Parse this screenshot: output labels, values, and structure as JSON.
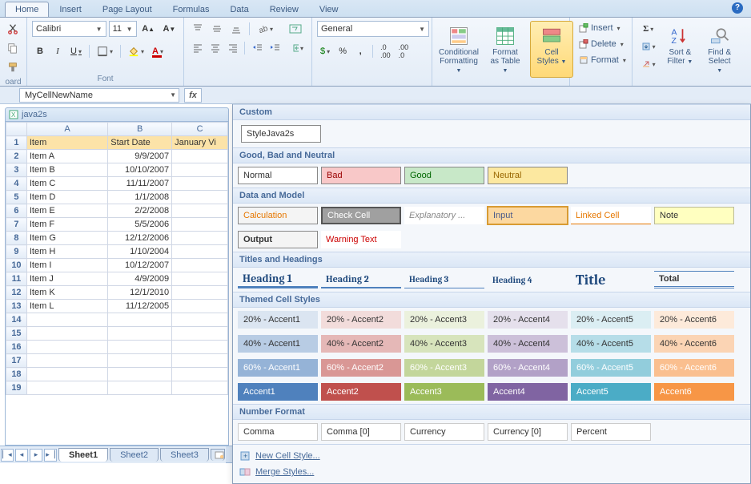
{
  "tabs": [
    "Home",
    "Insert",
    "Page Layout",
    "Formulas",
    "Data",
    "Review",
    "View"
  ],
  "activeTab": "Home",
  "font": {
    "name": "Calibri",
    "size": "11"
  },
  "numberFormatSelect": "General",
  "groups": {
    "clipboard": "oard",
    "font": "Font"
  },
  "bigButtons": {
    "conditional": "Conditional\nFormatting",
    "formatTable": "Format\nas Table",
    "cellStyles": "Cell\nStyles",
    "sortFilter": "Sort &\nFilter",
    "findSelect": "Find &\nSelect"
  },
  "cellsMenu": {
    "insert": "Insert",
    "delete": "Delete",
    "format": "Format"
  },
  "nameBox": "MyCellNewName",
  "workbookTitle": "java2s",
  "columns": [
    "A",
    "B",
    "C"
  ],
  "headerRow": {
    "A": "Item",
    "B": "Start Date",
    "C": "January Vi"
  },
  "rows": [
    {
      "A": "Item A",
      "B": "9/9/2007"
    },
    {
      "A": "Item B",
      "B": "10/10/2007"
    },
    {
      "A": "Item C",
      "B": "11/11/2007"
    },
    {
      "A": "Item D",
      "B": "1/1/2008"
    },
    {
      "A": "Item E",
      "B": "2/2/2008"
    },
    {
      "A": "Item F",
      "B": "5/5/2006"
    },
    {
      "A": "Item G",
      "B": "12/12/2006"
    },
    {
      "A": "Item H",
      "B": "1/10/2004"
    },
    {
      "A": "Item I",
      "B": "10/12/2007"
    },
    {
      "A": "Item J",
      "B": "4/9/2009"
    },
    {
      "A": "Item K",
      "B": "12/1/2010"
    },
    {
      "A": "Item L",
      "B": "11/12/2005"
    }
  ],
  "sheetTabs": [
    "Sheet1",
    "Sheet2",
    "Sheet3"
  ],
  "activeSheet": "Sheet1",
  "gallery": {
    "sections": {
      "custom": "Custom",
      "customStyle": "StyleJava2s",
      "goodBad": "Good, Bad and Neutral",
      "dataModel": "Data and Model",
      "titles": "Titles and Headings",
      "themed": "Themed Cell Styles",
      "numberFormat": "Number Format"
    },
    "goodBad": [
      "Normal",
      "Bad",
      "Good",
      "Neutral"
    ],
    "dataModel1": [
      "Calculation",
      "Check Cell",
      "Explanatory ...",
      "Input",
      "Linked Cell",
      "Note"
    ],
    "dataModel2": [
      "Output",
      "Warning Text"
    ],
    "headings": [
      "Heading 1",
      "Heading 2",
      "Heading 3",
      "Heading 4",
      "Title",
      "Total"
    ],
    "accent20": [
      "20% - Accent1",
      "20% - Accent2",
      "20% - Accent3",
      "20% - Accent4",
      "20% - Accent5",
      "20% - Accent6"
    ],
    "accent40": [
      "40% - Accent1",
      "40% - Accent2",
      "40% - Accent3",
      "40% - Accent4",
      "40% - Accent5",
      "40% - Accent6"
    ],
    "accent60": [
      "60% - Accent1",
      "60% - Accent2",
      "60% - Accent3",
      "60% - Accent4",
      "60% - Accent5",
      "60% - Accent6"
    ],
    "accent100": [
      "Accent1",
      "Accent2",
      "Accent3",
      "Accent4",
      "Accent5",
      "Accent6"
    ],
    "numFormats": [
      "Comma",
      "Comma [0]",
      "Currency",
      "Currency [0]",
      "Percent"
    ],
    "newStyle": "New Cell Style...",
    "mergeStyles": "Merge Styles..."
  }
}
